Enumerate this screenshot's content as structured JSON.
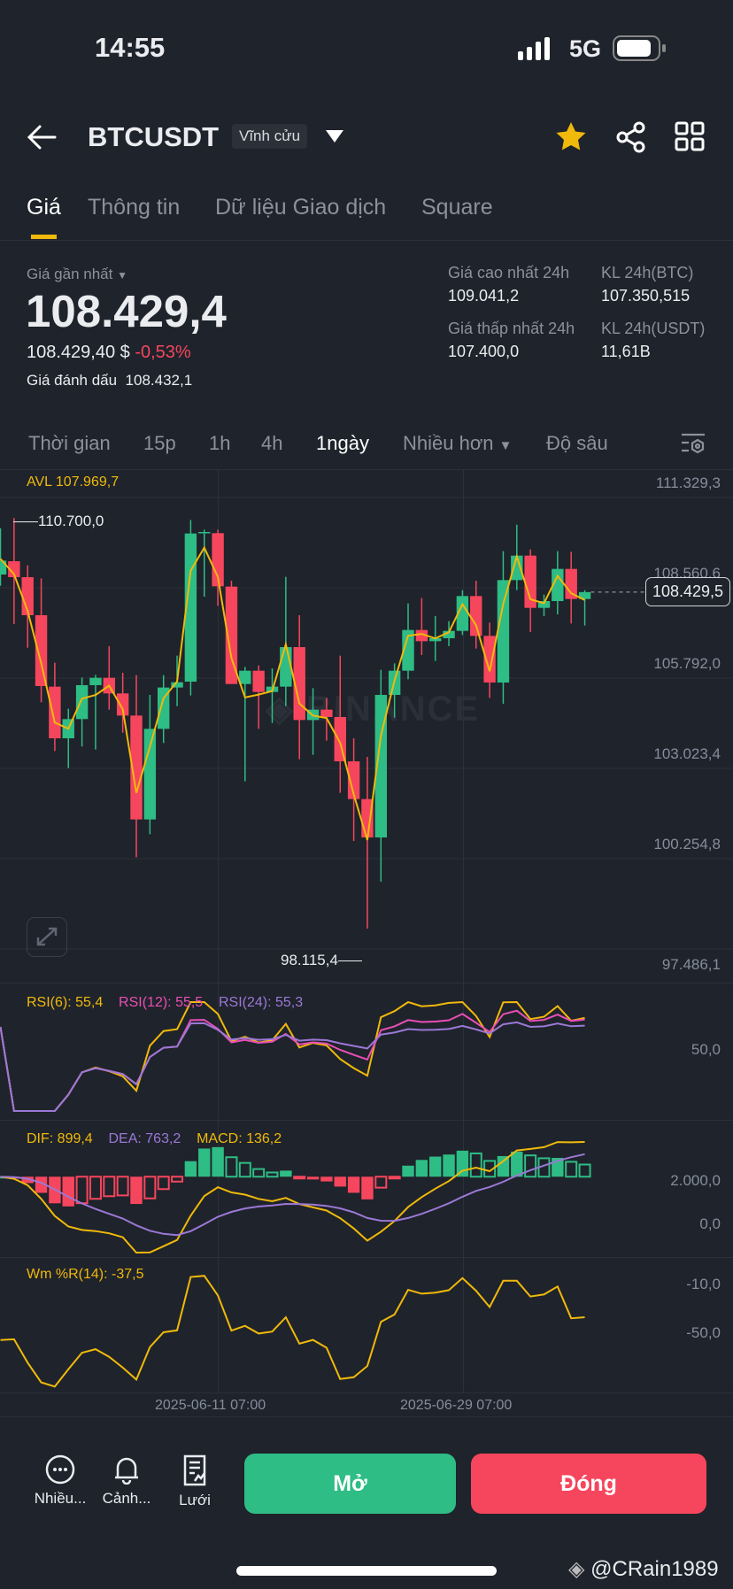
{
  "status_bar": {
    "time": "14:55",
    "network": "5G"
  },
  "header": {
    "symbol": "BTCUSDT",
    "badge": "Vĩnh cửu"
  },
  "tabs": [
    {
      "label": "Giá",
      "active": true
    },
    {
      "label": "Thông tin"
    },
    {
      "label": "Dữ liệu Giao dịch"
    },
    {
      "label": "Square"
    }
  ],
  "price": {
    "last_label": "Giá gần nhất",
    "last": "108.429,4",
    "usd": "108.429,40 $",
    "change": "-0,53%",
    "mark_label": "Giá đánh dấu",
    "mark": "108.432,1"
  },
  "stats": {
    "high_label": "Giá cao nhất 24h",
    "high": "109.041,2",
    "low_label": "Giá thấp nhất 24h",
    "low": "107.400,0",
    "vol_btc_label": "KL 24h(BTC)",
    "vol_btc": "107.350,515",
    "vol_usdt_label": "KL 24h(USDT)",
    "vol_usdt": "11,61B"
  },
  "intervals": {
    "time": "Thời gian",
    "i15": "15p",
    "i1h": "1h",
    "i4h": "4h",
    "i1d": "1ngày",
    "more": "Nhiều hơn",
    "depth": "Độ sâu"
  },
  "colors": {
    "up": "#2ebd85",
    "down": "#f6465d",
    "accent": "#f0b90b",
    "pink": "#e84fb5",
    "purple": "#9b78d6"
  },
  "chart_data": {
    "type": "candlestick",
    "interval": "1ngày",
    "avl_label": "AVL 107.969,7",
    "ylim": [
      97486.1,
      111329.3
    ],
    "y_ticks": [
      "111.329,3",
      "108.560,6",
      "105.792,0",
      "103.023,4",
      "100.254,8",
      "97.486,1"
    ],
    "y_tick_values": [
      111329.3,
      108560.6,
      105792.0,
      103023.4,
      100254.8,
      97486.1
    ],
    "current_price_tag": "108.429,5",
    "current_price": 108429.5,
    "high_marker": "110.700,0",
    "low_marker": "98.115,4",
    "x_labels": [
      {
        "label": "2025-06-11 07:00",
        "index": 16
      },
      {
        "label": "2025-06-29 07:00",
        "index": 34
      }
    ],
    "candles": [
      [
        108968,
        110388,
        108624,
        109393
      ],
      [
        109375,
        110700,
        107448,
        108886
      ],
      [
        108886,
        109248,
        106724,
        107720
      ],
      [
        107720,
        108850,
        105050,
        105548
      ],
      [
        105530,
        106263,
        103557,
        103946
      ],
      [
        103946,
        104851,
        103032,
        104535
      ],
      [
        104535,
        105810,
        103693,
        105575
      ],
      [
        105575,
        105892,
        103602,
        105801
      ],
      [
        105801,
        106769,
        104824,
        105322
      ],
      [
        105322,
        105955,
        104118,
        104643
      ],
      [
        104643,
        105882,
        100300,
        101458
      ],
      [
        101458,
        105276,
        101006,
        104236
      ],
      [
        104236,
        105882,
        103801,
        105503
      ],
      [
        105503,
        106480,
        104932,
        105665
      ],
      [
        105683,
        110642,
        105258,
        110226
      ],
      [
        110244,
        110343,
        108289,
        110271
      ],
      [
        110235,
        110343,
        108009,
        108606
      ],
      [
        108597,
        108778,
        105611,
        105611
      ],
      [
        105611,
        106136,
        102625,
        106018
      ],
      [
        106018,
        106181,
        104236,
        105367
      ],
      [
        105367,
        106091,
        104417,
        105530
      ],
      [
        105530,
        108895,
        104932,
        106742
      ],
      [
        106742,
        107719,
        103304,
        104507
      ],
      [
        104507,
        105484,
        103440,
        104824
      ],
      [
        104824,
        105186,
        103874,
        104598
      ],
      [
        104598,
        106480,
        102272,
        103240
      ],
      [
        103240,
        103946,
        100797,
        102082
      ],
      [
        102082,
        103376,
        98115,
        100906
      ],
      [
        100906,
        106045,
        99549,
        105276
      ],
      [
        105276,
        106244,
        104580,
        106018
      ],
      [
        106018,
        108081,
        105756,
        107267
      ],
      [
        107267,
        108244,
        106498,
        106923
      ],
      [
        106923,
        107692,
        106317,
        107014
      ],
      [
        107014,
        107538,
        106769,
        107240
      ],
      [
        107240,
        108488,
        107113,
        108307
      ],
      [
        108307,
        108778,
        106697,
        107086
      ],
      [
        107086,
        107493,
        105187,
        105656
      ],
      [
        105656,
        109683,
        105005,
        108796
      ],
      [
        108796,
        110497,
        108488,
        109547
      ],
      [
        109547,
        109737,
        107204,
        107945
      ],
      [
        107945,
        108353,
        107692,
        108154
      ],
      [
        108154,
        109683,
        107746,
        109140
      ],
      [
        109140,
        109665,
        107466,
        108217
      ],
      [
        108217,
        108488,
        107403,
        108429
      ]
    ],
    "rsi": {
      "labels": [
        "RSI(6): 55,4",
        "RSI(12): 55,5",
        "RSI(24): 55,3"
      ],
      "axis": "50,0"
    },
    "macd": {
      "labels": [
        "DIF: 899,4",
        "DEA: 763,2",
        "MACD: 136,2"
      ],
      "axis": [
        "2.000,0",
        "0,0"
      ]
    },
    "wr": {
      "label": "Wm %R(14): -37,5",
      "axis": [
        "-10,0",
        "-50,0"
      ]
    }
  },
  "watermark": "BINANCE",
  "bottom_bar": {
    "more": "Nhiều...",
    "alert": "Cảnh...",
    "grid": "Lưới",
    "open": "Mở",
    "close": "Đóng"
  },
  "credit": "@CRain1989"
}
